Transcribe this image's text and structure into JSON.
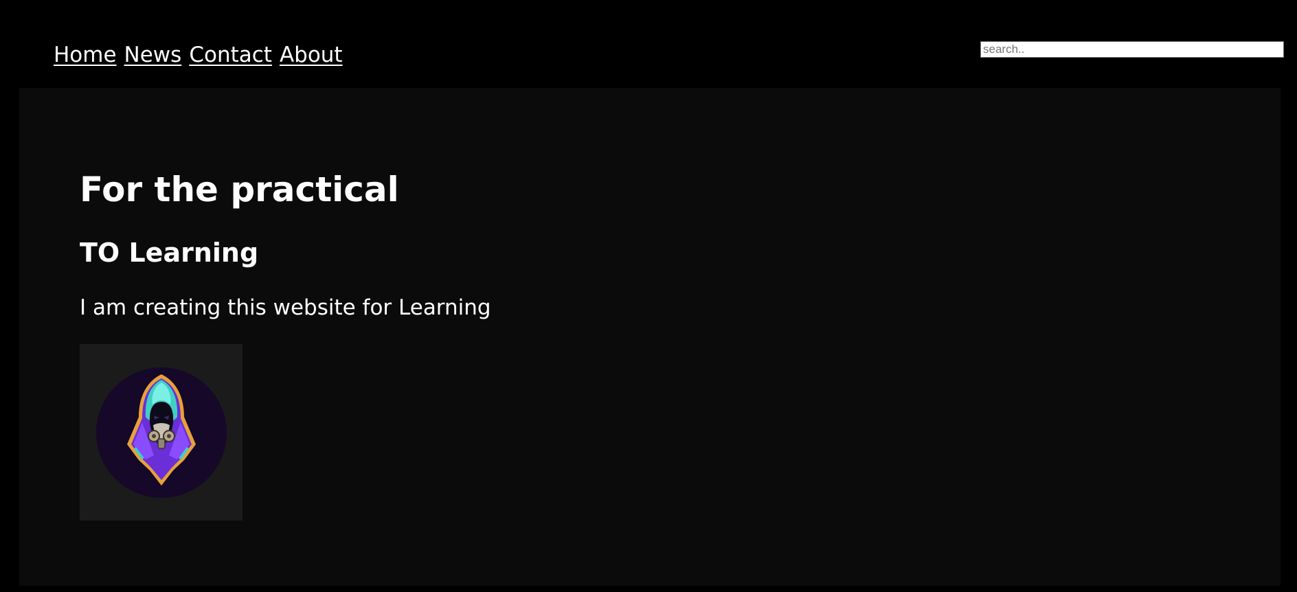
{
  "nav": {
    "items": [
      {
        "label": "Home"
      },
      {
        "label": "News"
      },
      {
        "label": "Contact"
      },
      {
        "label": "About"
      }
    ]
  },
  "search": {
    "placeholder": "search..",
    "value": ""
  },
  "main": {
    "title": "For the practical",
    "subtitle": "TO Learning",
    "paragraph": "I am creating this website for Learning",
    "image": {
      "icon": "hooded-figure-gas-mask-icon"
    }
  },
  "colors": {
    "page_background": "#000000",
    "content_background": "#0b0b0b",
    "image_frame": "#1b1b1b",
    "text": "#ffffff",
    "logo_circle": "#160828",
    "hood_teal": "#3fd0c4",
    "cloak_purple": "#7b3ff2",
    "outline_orange": "#e8a13a"
  }
}
